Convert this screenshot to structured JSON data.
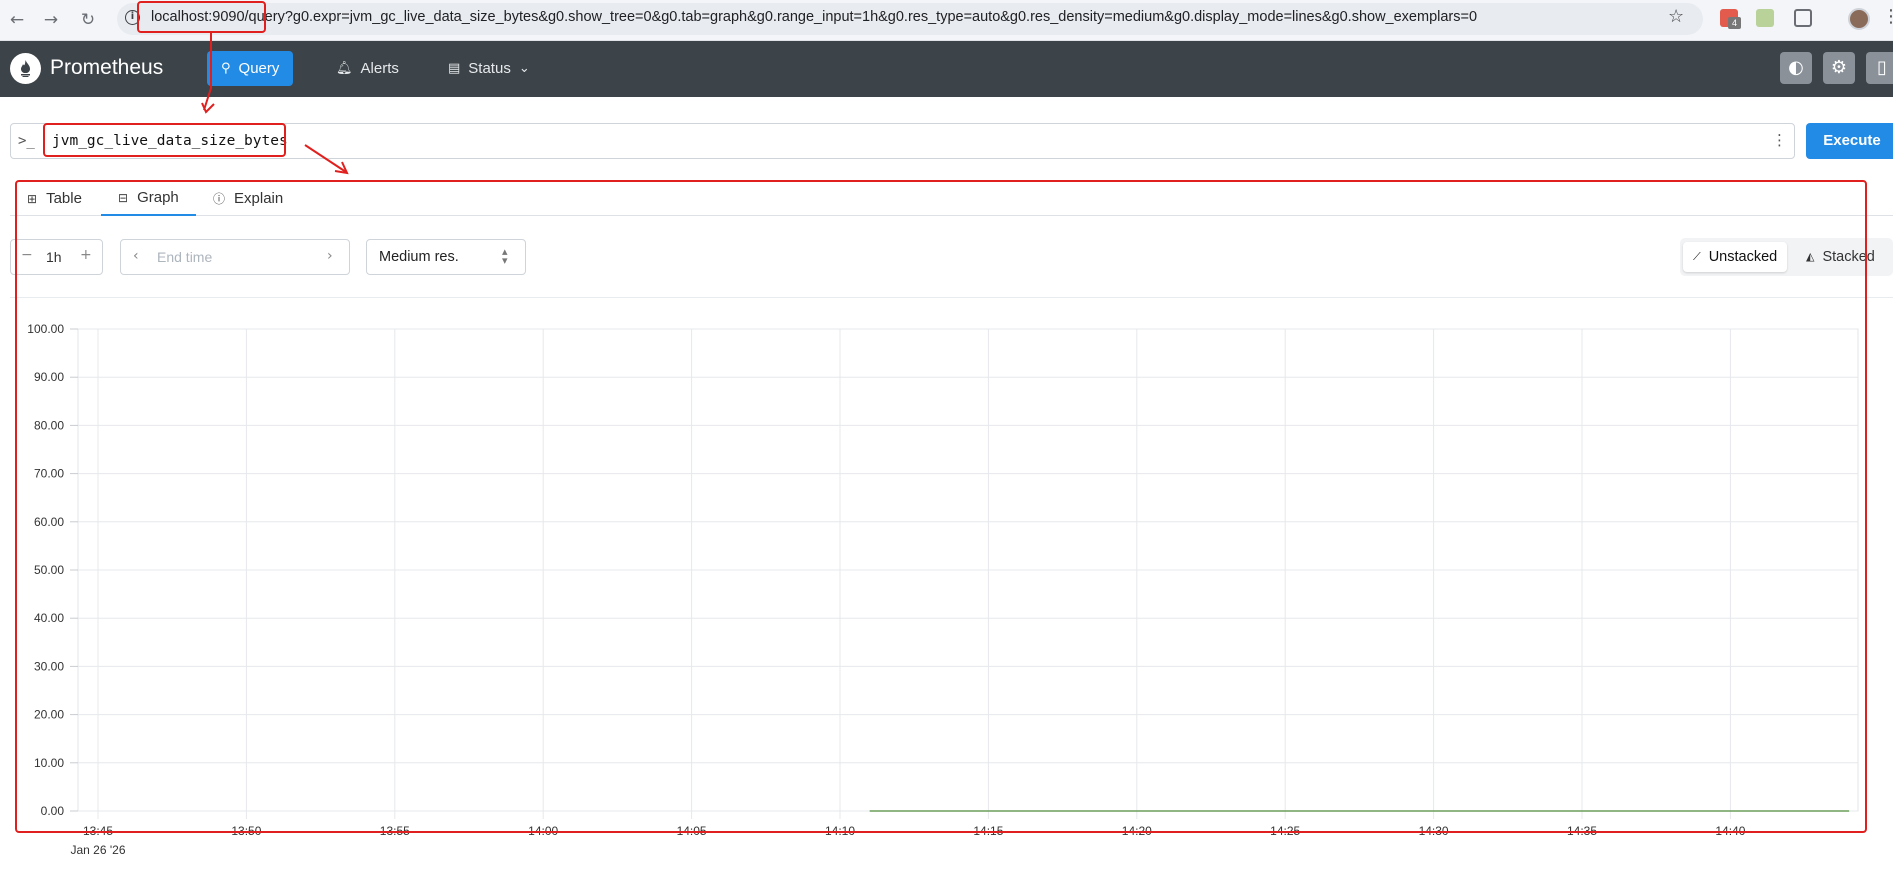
{
  "browser": {
    "url": "localhost:9090/query?g0.expr=jvm_gc_live_data_size_bytes&g0.show_tree=0&g0.tab=graph&g0.range_input=1h&g0.res_type=auto&g0.res_density=medium&g0.display_mode=lines&g0.show_exemplars=0",
    "extension_badge": "4"
  },
  "header": {
    "title": "Prometheus",
    "nav": [
      {
        "label": "Query",
        "icon": "search-icon",
        "active": true
      },
      {
        "label": "Alerts",
        "icon": "bell-icon",
        "active": false
      },
      {
        "label": "Status",
        "icon": "server-icon",
        "active": false
      }
    ]
  },
  "query": {
    "expression": "jvm_gc_live_data_size_bytes",
    "execute_label": "Execute"
  },
  "tabs": [
    {
      "label": "Table",
      "icon": "table-icon"
    },
    {
      "label": "Graph",
      "icon": "graph-icon",
      "active": true
    },
    {
      "label": "Explain",
      "icon": "info-icon"
    }
  ],
  "controls": {
    "range": "1h",
    "end_time_placeholder": "End time",
    "resolution": "Medium res.",
    "unstacked_label": "Unstacked",
    "stacked_label": "Stacked"
  },
  "chart_data": {
    "type": "line",
    "y_ticks": [
      "100.00",
      "90.00",
      "80.00",
      "70.00",
      "60.00",
      "50.00",
      "40.00",
      "30.00",
      "20.00",
      "10.00",
      "0.00"
    ],
    "x_ticks": [
      "13:45",
      "13:50",
      "13:55",
      "14:00",
      "14:05",
      "14:10",
      "14:15",
      "14:20",
      "14:25",
      "14:30",
      "14:35",
      "14:40"
    ],
    "date_label": "Jan 26 '26",
    "ylim": [
      0,
      100
    ],
    "series": [
      {
        "color": "#6a9e5a",
        "x_start": "14:11",
        "x_end": "14:44",
        "values": [
          0,
          0
        ]
      }
    ]
  }
}
